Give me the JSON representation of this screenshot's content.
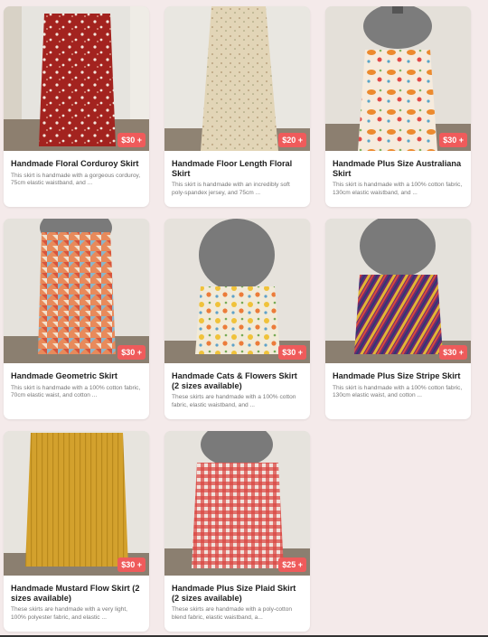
{
  "products": [
    {
      "title": "Handmade Floral Corduroy Skirt",
      "desc": "This skirt is handmade with a gorgeous corduroy, 75cm elastic waistband, and ...",
      "price": "$30 +"
    },
    {
      "title": "Handmade Floor Length Floral Skirt",
      "desc": "This skirt is handmade with an incredibly soft poly-spandex jersey, and 75cm ...",
      "price": "$20 +"
    },
    {
      "title": "Handmade Plus Size Australiana Skirt",
      "desc": "This skirt is handmade with a 100% cotton fabric, 130cm elastic waistband, and ...",
      "price": "$30 +"
    },
    {
      "title": "Handmade Geometric Skirt",
      "desc": "This skirt is handmade with a 100% cotton fabric, 70cm elastic waist, and cotton ...",
      "price": "$30 +"
    },
    {
      "title": "Handmade Cats & Flowers Skirt (2 sizes available)",
      "desc": "These skirts are handmade with a 100% cotton fabric, elastic waistband, and ...",
      "price": "$30 +"
    },
    {
      "title": "Handmade Plus Size Stripe Skirt",
      "desc": "This skirt is handmade with a 100% cotton fabric, 130cm elastic waist, and cotton ...",
      "price": "$30 +"
    },
    {
      "title": "Handmade Mustard Flow Skirt (2 sizes available)",
      "desc": "These skirts are handmade with a very light, 100% polyester fabric, and elastic ...",
      "price": "$30 +"
    },
    {
      "title": "Handmade Plus Size Plaid Skirt (2 sizes available)",
      "desc": "These skirts are handmade with a poly-cotton blend fabric, elastic waistband, a...",
      "price": "$25 +"
    }
  ],
  "colors": {
    "page_bg": "#f4eaea",
    "price_badge": "#ef5b5b",
    "card_bg": "#ffffff"
  }
}
